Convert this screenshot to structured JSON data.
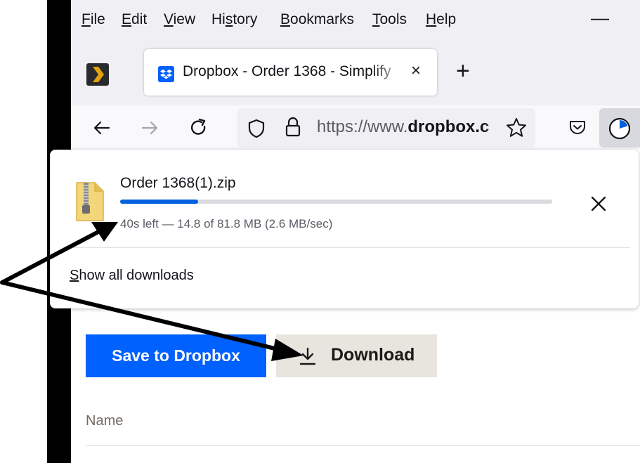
{
  "menu": {
    "items": [
      {
        "prefix": "",
        "key": "F",
        "rest": "ile"
      },
      {
        "prefix": "",
        "key": "E",
        "rest": "dit"
      },
      {
        "prefix": "",
        "key": "V",
        "rest": "iew"
      },
      {
        "prefix": "Hi",
        "key": "s",
        "rest": "tory"
      },
      {
        "prefix": "",
        "key": "B",
        "rest": "ookmarks"
      },
      {
        "prefix": "",
        "key": "T",
        "rest": "ools"
      },
      {
        "prefix": "",
        "key": "H",
        "rest": "elp"
      }
    ],
    "minimize": "—"
  },
  "tab": {
    "title": "Dropbox - Order 1368 - Simplify",
    "close": "×",
    "new_tab": "+"
  },
  "urlbar": {
    "prefix": "https://www.",
    "domain": "dropbox.c"
  },
  "download": {
    "file_name": "Order 1368(1).zip",
    "progress_fraction": 0.181,
    "status": "40s left — 14.8 of 81.8 MB (2.6 MB/sec)",
    "show_all": {
      "key": "S",
      "rest": "how all downloads"
    }
  },
  "page": {
    "save_label": "Save to Dropbox",
    "download_label": "Download",
    "name_column": "Name"
  },
  "colors": {
    "dropbox_blue": "#0061fe",
    "progress_blue": "#0060df",
    "download_button_bg": "#e8e5de",
    "arrow": "#000000"
  },
  "icons": [
    "plex-icon",
    "dropbox-favicon",
    "back-arrow-icon",
    "forward-arrow-icon",
    "reload-icon",
    "shield-icon",
    "lock-icon",
    "star-icon",
    "pocket-icon",
    "downloads-progress-icon",
    "zip-file-icon",
    "close-icon",
    "download-icon"
  ]
}
